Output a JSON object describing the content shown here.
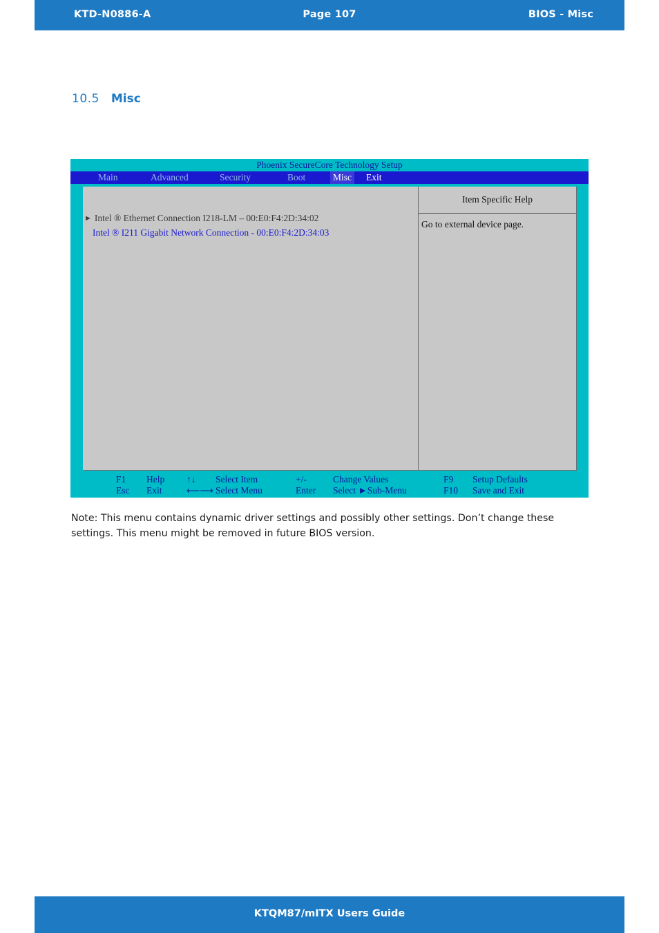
{
  "header": {
    "doc_id": "KTD-N0886-A",
    "page": "Page 107",
    "section": "BIOS  - Misc"
  },
  "heading": {
    "number": "10.5",
    "title": "Misc"
  },
  "bios": {
    "title": "Phoenix SecureCore Technology Setup",
    "menu": [
      {
        "label": "Main",
        "active": false
      },
      {
        "label": "Advanced",
        "active": false
      },
      {
        "label": "Security",
        "active": false
      },
      {
        "label": "Boot",
        "active": false
      },
      {
        "label": "Misc",
        "active": true
      },
      {
        "label": "Exit",
        "active": false
      }
    ],
    "items": [
      {
        "arrow": "►",
        "label": "Intel ® Ethernet Connection I218-LM – 00:E0:F4:2D:34:02"
      },
      {
        "arrow": "",
        "label": "Intel ® I211 Gigabit Network Connection - 00:E0:F4:2D:34:03"
      }
    ],
    "help": {
      "title": "Item Specific Help",
      "text": "Go to external device page."
    },
    "footer": {
      "row1": {
        "key": "F1",
        "action": "Help",
        "nav_key": "↑↓",
        "nav_action": "Select Item",
        "pm_key": "+/-",
        "pm_action": "Change Values",
        "f_key": "F9",
        "f_action": "Setup Defaults"
      },
      "row2": {
        "key": "Esc",
        "action": "Exit",
        "nav_key": "⟵⟶",
        "nav_action": "Select Menu",
        "pm_key": "Enter",
        "pm_action": "Select ►Sub-Menu",
        "f_key": "F10",
        "f_action": "Save and Exit"
      }
    }
  },
  "note": "Note: This menu contains dynamic driver settings and possibly other settings. Don’t change these settings. This menu might be removed in future BIOS version.",
  "footer": {
    "title": "KTQM87/mITX Users Guide"
  }
}
